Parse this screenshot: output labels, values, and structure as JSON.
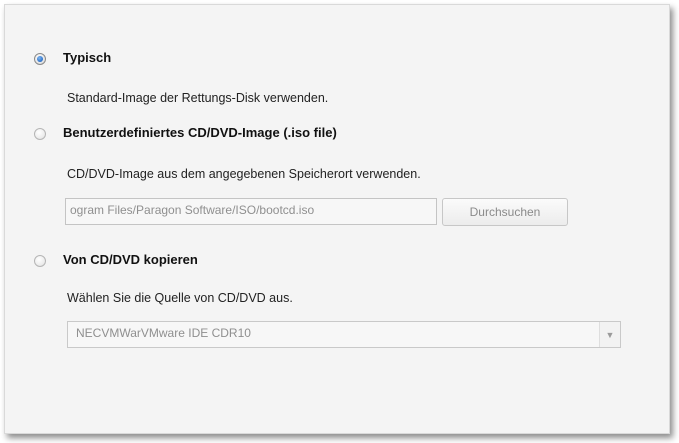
{
  "options": [
    {
      "title": "Typisch",
      "description": "Standard-Image der Rettungs-Disk verwenden.",
      "selected": true
    },
    {
      "title": "Benutzerdefiniertes CD/DVD-Image (.iso file)",
      "description": "CD/DVD-Image aus dem angegebenen Speicherort verwenden.",
      "selected": false
    },
    {
      "title": "Von CD/DVD kopieren",
      "description": "Wählen Sie die Quelle von CD/DVD aus.",
      "selected": false
    }
  ],
  "iso_path": {
    "value": "ogram Files/Paragon Software/ISO/bootcd.iso",
    "browse_label": "Durchsuchen"
  },
  "drive_select": {
    "value": "NECVMWarVMware IDE CDR10",
    "arrow_icon": "chevron-down-icon"
  },
  "colors": {
    "panel_bg": "#f4f4f4",
    "radio_accent": "#2a6fc9",
    "disabled_text": "#8f8f8f"
  }
}
